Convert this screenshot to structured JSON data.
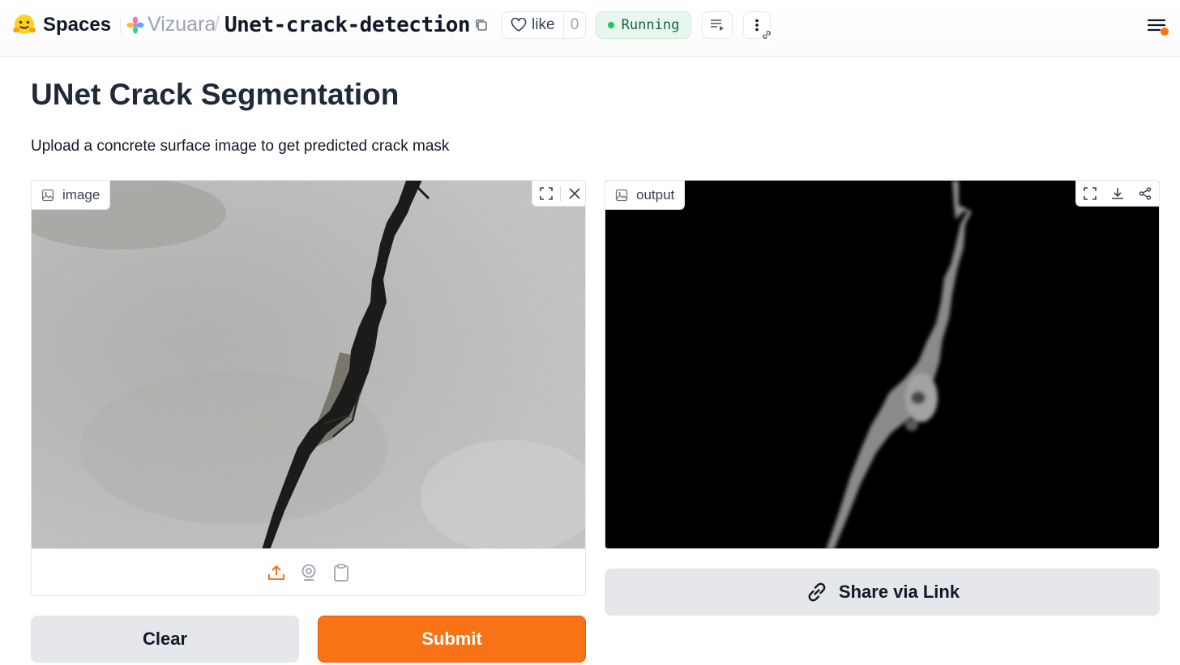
{
  "header": {
    "brand_label": "Spaces",
    "org_name": "Vizuara",
    "separator": "/",
    "repo_name": "Unet-crack-detection",
    "like_label": "like",
    "like_count": "0",
    "status_label": "Running"
  },
  "main": {
    "title": "UNet Crack Segmentation",
    "description": "Upload a concrete surface image to get predicted crack mask",
    "input_panel": {
      "label": "image"
    },
    "output_panel": {
      "label": "output"
    },
    "buttons": {
      "clear": "Clear",
      "submit": "Submit",
      "share": "Share via Link"
    }
  },
  "colors": {
    "accent": "#f97316",
    "status_bg": "#e7f7ee",
    "status_text": "#166534",
    "secondary_button": "#e5e7eb"
  },
  "icons": [
    "hugging-face-logo",
    "org-flower-icon",
    "copy-icon",
    "heart-icon",
    "playlist-icon",
    "more-vertical-icon",
    "link-icon",
    "hamburger-menu-icon",
    "image-icon",
    "fullscreen-icon",
    "close-icon",
    "download-icon",
    "share-icon",
    "upload-icon",
    "webcam-icon",
    "clipboard-icon"
  ]
}
